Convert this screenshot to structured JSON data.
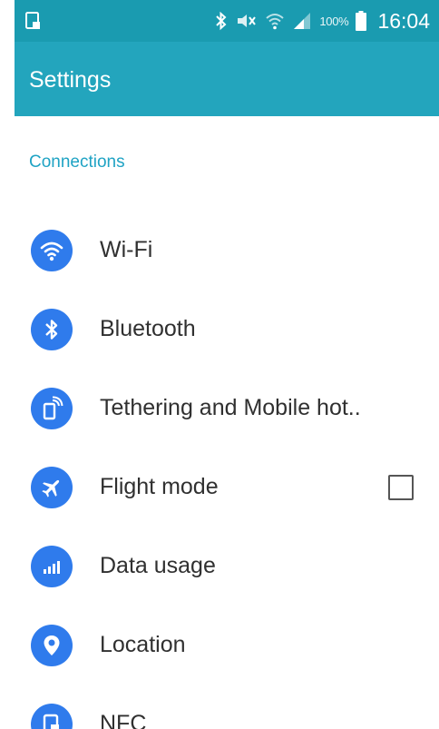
{
  "status_bar": {
    "battery": "100%",
    "time": "16:04",
    "icons": [
      "screenshot-icon",
      "bluetooth-icon",
      "mute-icon",
      "wifi-icon",
      "signal-icon",
      "battery-icon"
    ]
  },
  "app_bar": {
    "title": "Settings"
  },
  "section": {
    "title": "Connections"
  },
  "items": [
    {
      "label": "Wi-Fi",
      "icon": "wifi-icon"
    },
    {
      "label": "Bluetooth",
      "icon": "bluetooth-icon"
    },
    {
      "label": "Tethering and Mobile hot..",
      "icon": "hotspot-icon"
    },
    {
      "label": "Flight mode",
      "icon": "airplane-icon",
      "checked": false
    },
    {
      "label": "Data usage",
      "icon": "data-usage-icon"
    },
    {
      "label": "Location",
      "icon": "location-pin-icon"
    },
    {
      "label": "NFC",
      "icon": "nfc-icon"
    }
  ],
  "colors": {
    "status_bar": "#1a9bb0",
    "app_bar": "#23a5bd",
    "section_title": "#1fa3c4",
    "icon_circle": "#2f7bec",
    "text": "#303030"
  }
}
